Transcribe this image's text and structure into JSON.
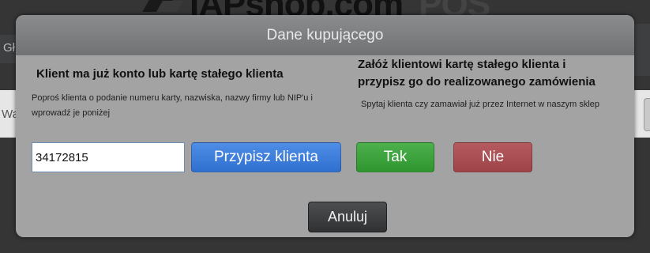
{
  "background": {
    "logo_text": "IAPshop.com",
    "logo_suffix": "POS",
    "left_strip_text_1": "Gł",
    "left_strip_text_2": "Wa"
  },
  "dialog": {
    "title": "Dane kupującego",
    "existing": {
      "heading": "Klient ma już konto lub kartę stałego klienta",
      "description": "Poproś klienta o podanie numeru karty, nazwiska, nazwy firmy lub NIP'u i wprowadź je poniżej",
      "input_value": "34172815",
      "assign_button": "Przypisz klienta"
    },
    "new_card": {
      "heading_line1": "Załóż klientowi kartę stałego klienta i",
      "heading_line2": "przypisz go do realizowanego zamówienia",
      "description": "Spytaj klienta czy zamawiał już przez Internet w naszym sklep",
      "yes_button": "Tak",
      "no_button": "Nie"
    },
    "cancel_button": "Anuluj"
  },
  "colors": {
    "assign": "#3a7bd9",
    "yes": "#3aa33a",
    "no": "#a94f53",
    "cancel": "#3c3e40"
  }
}
